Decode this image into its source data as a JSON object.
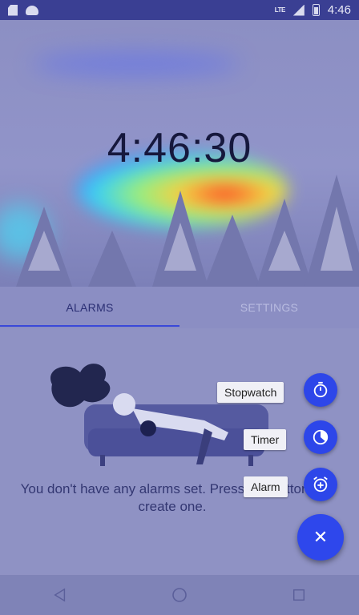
{
  "status_bar": {
    "time": "4:46",
    "network": "LTE",
    "icons": [
      "sd-card-icon",
      "android-icon",
      "signal-icon",
      "battery-icon"
    ]
  },
  "clock": {
    "time": "4:46:30"
  },
  "tabs": [
    {
      "label": "ALARMS",
      "selected": true
    },
    {
      "label": "SETTINGS",
      "selected": false
    }
  ],
  "empty_state": {
    "message": "You don't have any alarms set. Press the button to create one."
  },
  "fab_menu": [
    {
      "label": "Stopwatch",
      "icon": "stopwatch-icon"
    },
    {
      "label": "Timer",
      "icon": "timer-icon"
    },
    {
      "label": "Alarm",
      "icon": "alarm-add-icon"
    }
  ],
  "fab": {
    "icon": "close-icon",
    "glyph": "✕"
  },
  "nav_bar": {
    "icons": [
      "back-icon",
      "home-icon",
      "recents-icon"
    ]
  },
  "colors": {
    "accent": "#2e47ec",
    "status_bar": "#3a3f93",
    "tab_indicator": "#3a48d9"
  }
}
